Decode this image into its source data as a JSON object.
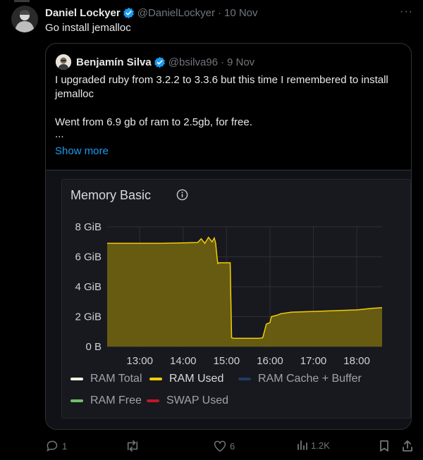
{
  "tweet": {
    "author_name": "Daniel Lockyer",
    "handle": "@DanielLockyer",
    "date": "10 Nov",
    "text": "Go install jemalloc",
    "more": "···"
  },
  "quote": {
    "author_name": "Benjamín Silva",
    "handle": "@bsilva96",
    "date": "9 Nov",
    "line1": "I upgraded ruby from 3.2.2 to 3.3.6 but this time I remembered to install jemalloc",
    "line2": "Went from 6.9 gb of ram to 2.5gb, for free.",
    "ellipsis": "...",
    "show_more": "Show more"
  },
  "panel": {
    "title": "Memory Basic"
  },
  "actions": {
    "replies": "1",
    "reposts": "",
    "likes": "6",
    "views": "1.2K"
  },
  "colors": {
    "accent": "#1d9bf0",
    "ram_used": "#f2cc0c",
    "ram_fill": "#6b5f12"
  },
  "chart_data": {
    "type": "area",
    "title": "Memory Basic",
    "x_ticks": [
      "13:00",
      "14:00",
      "15:00",
      "16:00",
      "17:00",
      "18:00"
    ],
    "y_ticks": [
      "0 B",
      "2 GiB",
      "4 GiB",
      "6 GiB",
      "8 GiB"
    ],
    "ylim": [
      0,
      8
    ],
    "xlim": [
      "12:15",
      "18:35"
    ],
    "grid": true,
    "legend_position": "bottom",
    "legend": [
      {
        "name": "RAM Total",
        "color": "#e8f5e0"
      },
      {
        "name": "RAM Used",
        "color": "#f2cc0c"
      },
      {
        "name": "RAM Cache + Buffer",
        "color": "#1f3a66"
      },
      {
        "name": "RAM Free",
        "color": "#73bf69"
      },
      {
        "name": "SWAP Used",
        "color": "#c4162a"
      }
    ],
    "series": [
      {
        "name": "RAM Used",
        "x": [
          "12:15",
          "13:30",
          "14:20",
          "14:25",
          "14:30",
          "14:35",
          "14:40",
          "14:43",
          "14:45",
          "14:47",
          "14:48",
          "14:50",
          "15:05",
          "15:07",
          "15:10",
          "15:45",
          "15:50",
          "15:55",
          "16:00",
          "16:02",
          "16:10",
          "16:15",
          "16:30",
          "17:00",
          "17:30",
          "18:00",
          "18:20",
          "18:35"
        ],
        "y": [
          6.9,
          6.9,
          6.95,
          7.2,
          6.9,
          7.3,
          7.0,
          7.25,
          6.9,
          5.9,
          5.55,
          5.6,
          5.6,
          0.6,
          0.55,
          0.55,
          0.6,
          1.5,
          1.6,
          2.0,
          2.1,
          2.2,
          2.3,
          2.35,
          2.4,
          2.45,
          2.55,
          2.6
        ]
      }
    ]
  }
}
